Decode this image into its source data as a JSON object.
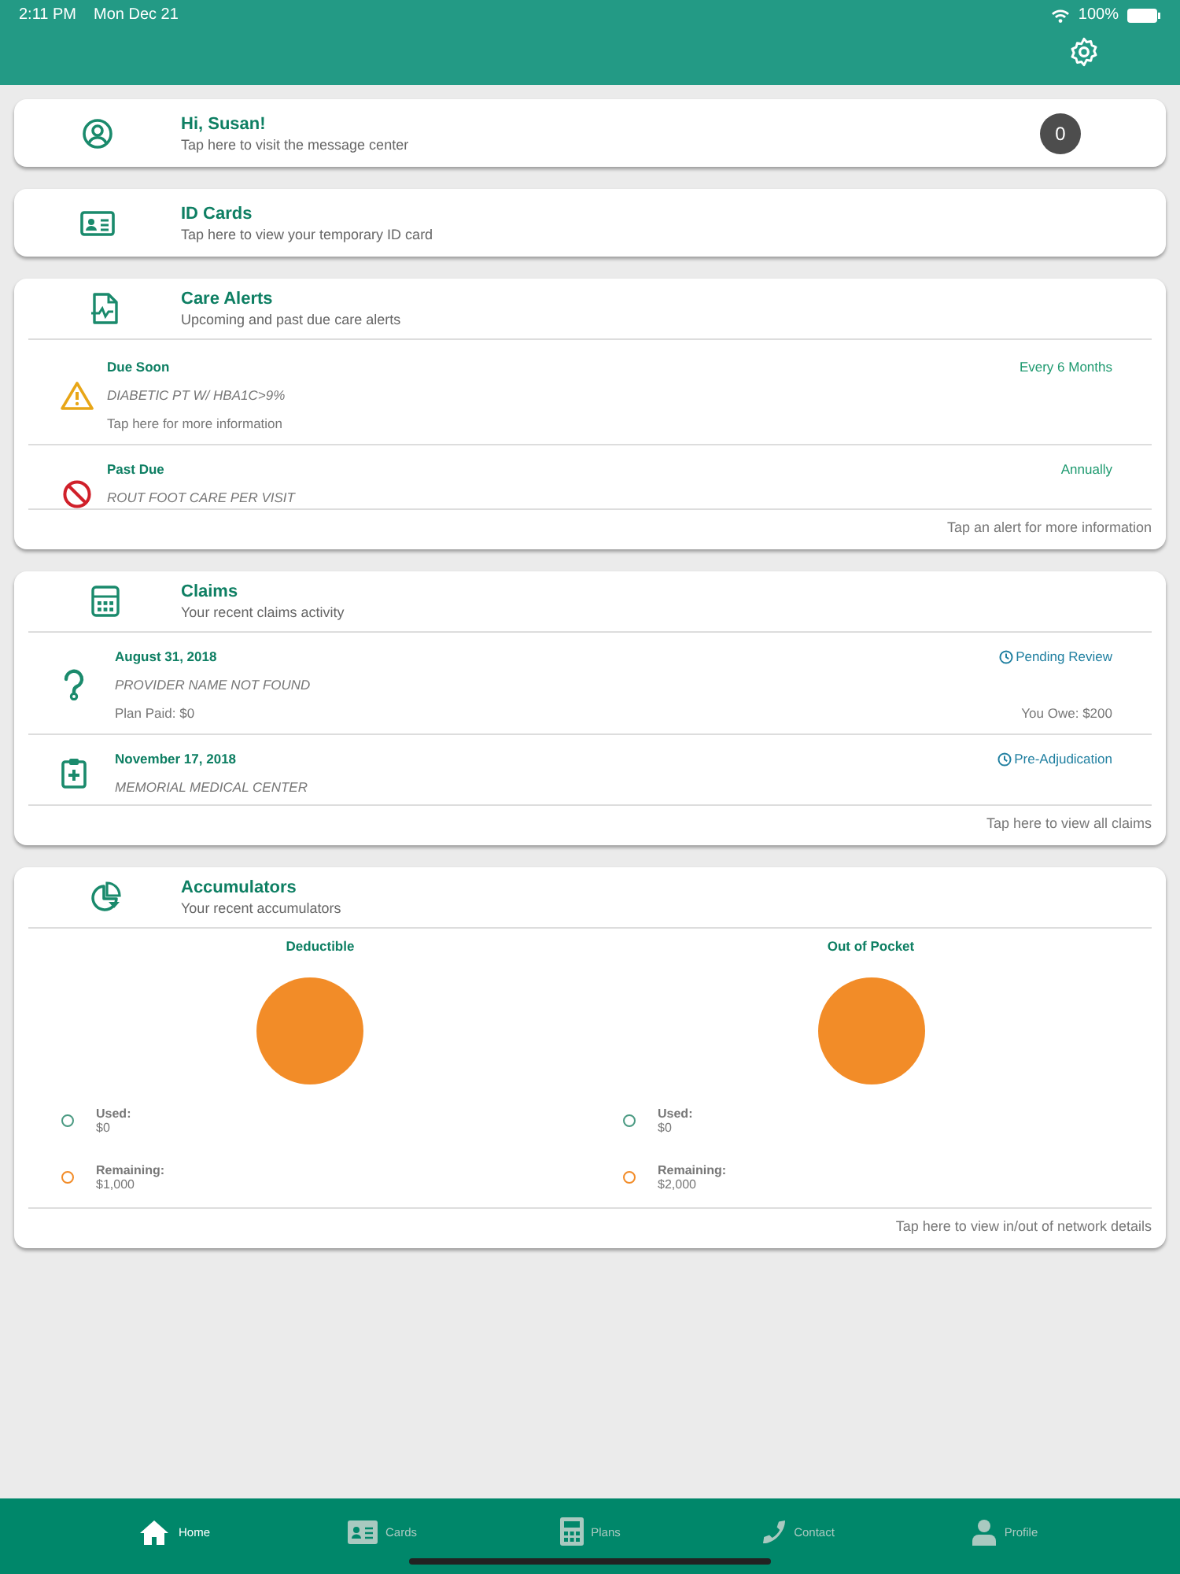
{
  "status_bar": {
    "time": "2:11 PM",
    "date": "Mon Dec 21",
    "battery": "100%"
  },
  "greeting": {
    "title": "Hi, Susan!",
    "subtitle": "Tap here to visit the message center",
    "badge": "0"
  },
  "id_cards": {
    "title": "ID Cards",
    "subtitle": "Tap here to view your temporary ID card"
  },
  "care_alerts": {
    "title": "Care Alerts",
    "subtitle": "Upcoming and past due care alerts",
    "items": [
      {
        "kind": "due",
        "status": "Due Soon",
        "frequency": "Every 6 Months",
        "name": "DIABETIC PT W/ HBA1C>9%",
        "hint": "Tap here for more information"
      },
      {
        "kind": "past",
        "status": "Past Due",
        "frequency": "Annually",
        "name": "ROUT FOOT CARE PER VISIT"
      }
    ],
    "footer": "Tap an alert for more information"
  },
  "claims": {
    "title": "Claims",
    "subtitle": "Your recent claims activity",
    "items": [
      {
        "kind": "unknown",
        "date": "August 31, 2018",
        "status": "Pending Review",
        "provider": "PROVIDER NAME NOT FOUND",
        "plan_paid": "Plan Paid: $0",
        "you_owe": "You Owe: $200"
      },
      {
        "kind": "medical",
        "date": "November 17, 2018",
        "status": "Pre-Adjudication",
        "provider": "MEMORIAL MEDICAL CENTER"
      }
    ],
    "footer": "Tap here to view all claims"
  },
  "accumulators": {
    "title": "Accumulators",
    "subtitle": "Your recent accumulators",
    "items": [
      {
        "title": "Deductible",
        "legend": [
          {
            "label": "Used:",
            "value": "$0",
            "color": "#4a9a82"
          },
          {
            "label": "Remaining:",
            "value": "$1,000",
            "color": "#f28c28"
          }
        ]
      },
      {
        "title": "Out of Pocket",
        "legend": [
          {
            "label": "Used:",
            "value": "$0",
            "color": "#4a9a82"
          },
          {
            "label": "Remaining:",
            "value": "$2,000",
            "color": "#f28c28"
          }
        ]
      }
    ],
    "footer": "Tap here to view in/out of network details"
  },
  "tabs": [
    {
      "kind": "home",
      "label": "Home",
      "selected": true
    },
    {
      "kind": "cards",
      "label": "Cards",
      "selected": false
    },
    {
      "kind": "plans",
      "label": "Plans",
      "selected": false
    },
    {
      "kind": "contact",
      "label": "Contact",
      "selected": false
    },
    {
      "kind": "profile",
      "label": "Profile",
      "selected": false
    }
  ]
}
